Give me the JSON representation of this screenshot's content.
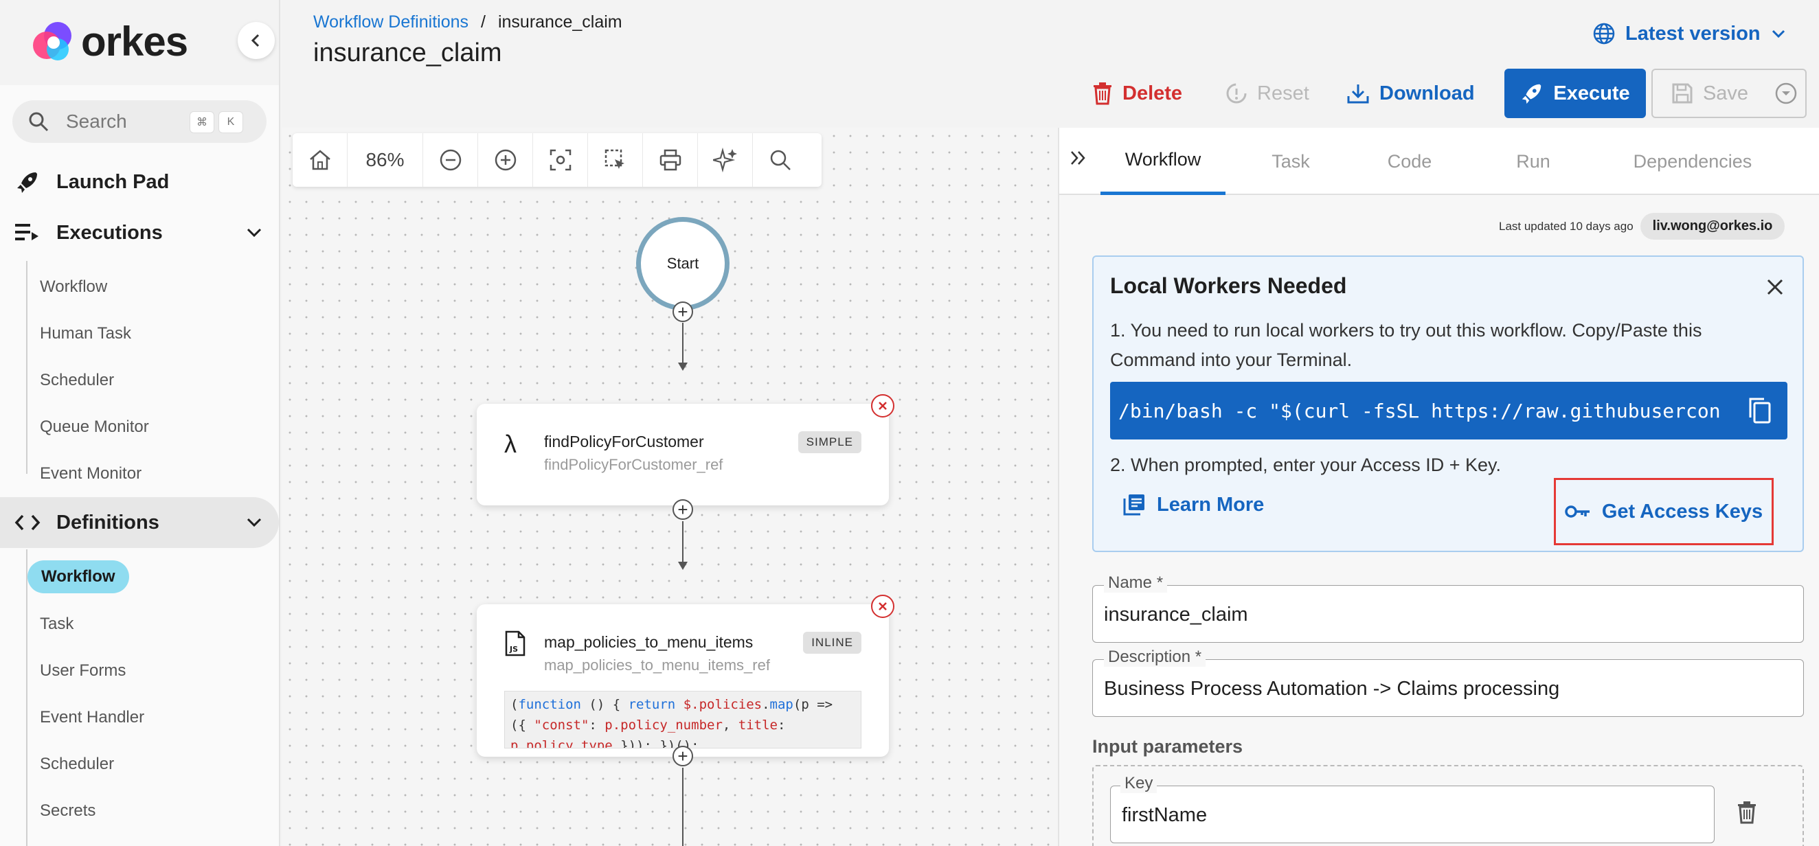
{
  "app": {
    "name": "orkes"
  },
  "sidebar": {
    "search_placeholder": "Search",
    "shortcut_keys": [
      "⌘",
      "K"
    ],
    "launch_pad": "Launch Pad",
    "executions": {
      "label": "Executions",
      "items": [
        "Workflow",
        "Human Task",
        "Scheduler",
        "Queue Monitor",
        "Event Monitor"
      ]
    },
    "definitions": {
      "label": "Definitions",
      "items": [
        "Workflow",
        "Task",
        "User Forms",
        "Event Handler",
        "Scheduler",
        "Secrets"
      ],
      "active_index": 0
    }
  },
  "header": {
    "breadcrumb": {
      "parent": "Workflow Definitions",
      "separator": "/",
      "current": "insurance_claim"
    },
    "title": "insurance_claim",
    "version": "Latest version",
    "actions": {
      "delete": "Delete",
      "reset": "Reset",
      "download": "Download",
      "execute": "Execute",
      "save": "Save"
    }
  },
  "canvas": {
    "zoom": "86%",
    "start_label": "Start",
    "tasks": [
      {
        "icon": "λ",
        "name": "findPolicyForCustomer",
        "ref": "findPolicyForCustomer_ref",
        "type": "SIMPLE"
      },
      {
        "icon": "js-file",
        "name": "map_policies_to_menu_items",
        "ref": "map_policies_to_menu_items_ref",
        "type": "INLINE",
        "code_lines": [
          "(function () { return $.policies.map(p =>",
          "({ \"const\": p.policy_number, title:",
          "p.policy_type })); })();"
        ]
      }
    ]
  },
  "panel": {
    "tabs": [
      "Workflow",
      "Task",
      "Code",
      "Run",
      "Dependencies"
    ],
    "active_tab": "Workflow",
    "last_updated": "Last updated 10 days ago",
    "user": "liv.wong@orkes.io",
    "notice": {
      "title": "Local Workers Needed",
      "step1": "1. You need to run local workers to try out this workflow. Copy/Paste this Command into your Terminal.",
      "command": "/bin/bash -c \"$(curl -fsSL https://raw.githubusercontent.com",
      "step2": "2. When prompted, enter your Access ID + Key.",
      "learn_more": "Learn More",
      "get_access_keys": "Get Access Keys"
    },
    "name_field": {
      "label": "Name *",
      "value": "insurance_claim"
    },
    "description_field": {
      "label": "Description *",
      "value": "Business Process Automation -> Claims processing"
    },
    "input_parameters": {
      "title": "Input parameters",
      "key_label": "Key",
      "key_value": "firstName"
    }
  },
  "colors": {
    "accent": "#1565c0",
    "danger": "#d32f2f",
    "active_pill": "#8fdcf0",
    "start_ring": "#7ba6bd"
  }
}
